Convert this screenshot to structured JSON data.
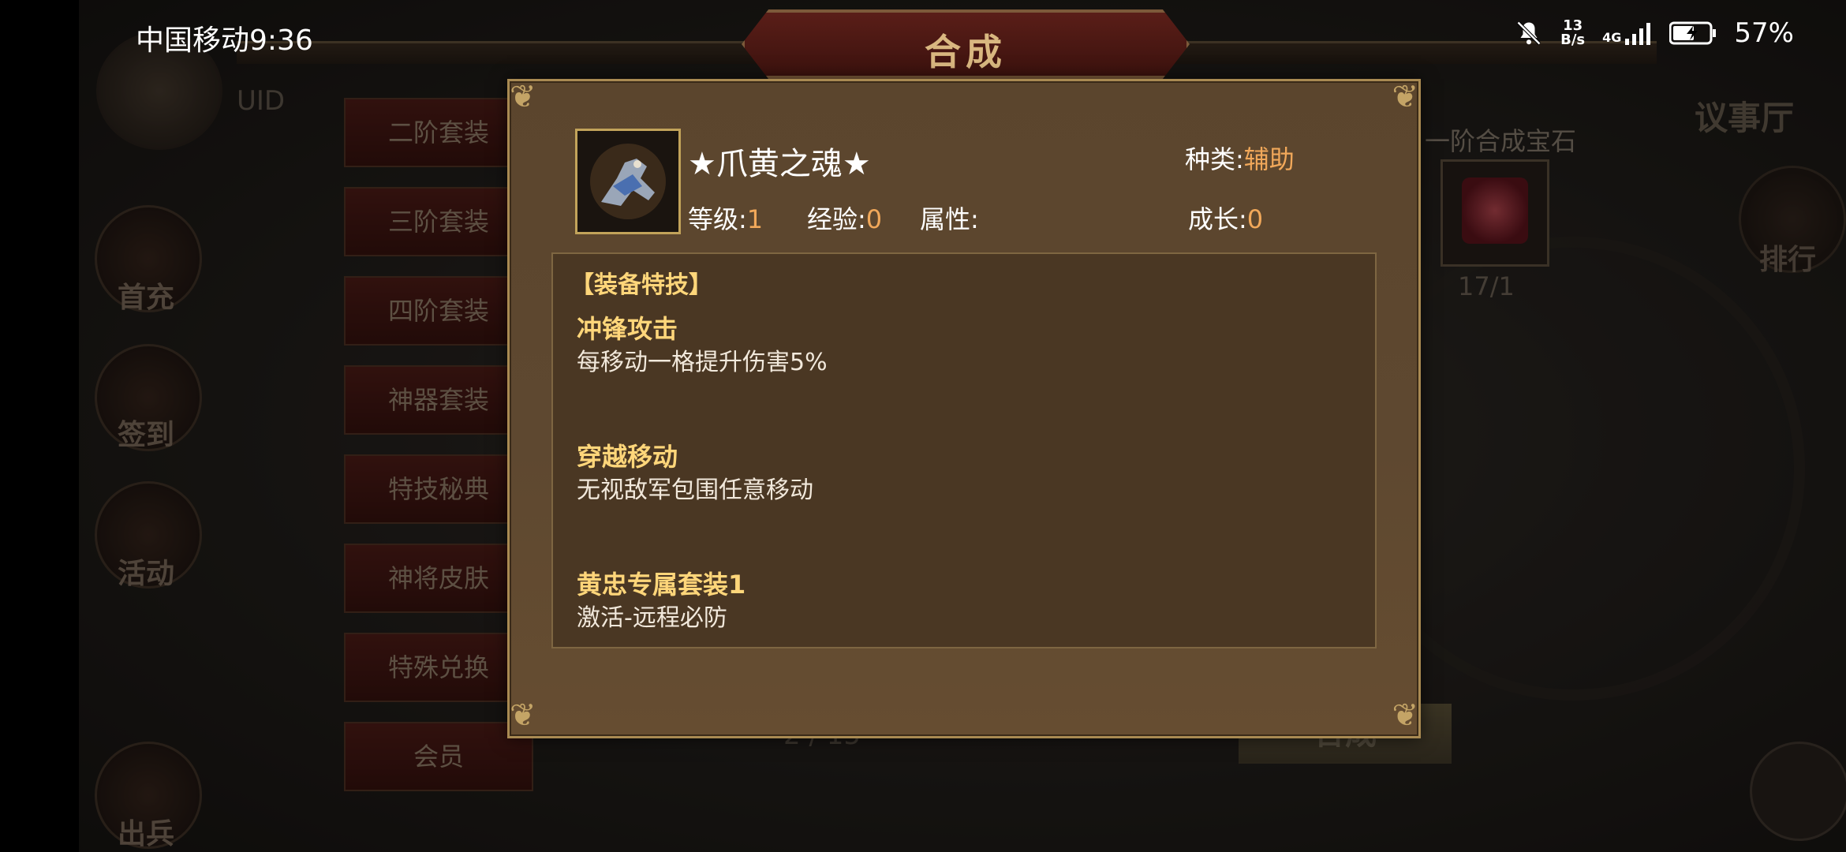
{
  "status_bar": {
    "carrier_time": "中国移动9:36",
    "net_speed_value": "13",
    "net_speed_unit": "B/s",
    "network": "4G",
    "battery": "57%"
  },
  "header": {
    "title": "合成"
  },
  "background": {
    "uid_label": "UID",
    "menu": [
      "二阶套装",
      "三阶套装",
      "四阶套装",
      "神器套装",
      "特技秘典",
      "神将皮肤",
      "特殊兑换",
      "会员"
    ],
    "left_icons": [
      "首充",
      "签到",
      "活动",
      "出兵"
    ],
    "gem_title": "一阶合成宝石",
    "gem_count": "17/1",
    "hall": "议事厅",
    "rank": "排行",
    "page": "2 / 15",
    "synth_button": "合成"
  },
  "item": {
    "name": "★爪黄之魂★",
    "kind_label": "种类:",
    "kind_value": "辅助",
    "level_label": "等级:",
    "level_value": "1",
    "exp_label": "经验:",
    "exp_value": "0",
    "attr_label": "属性:",
    "growth_label": "成长:",
    "growth_value": "0"
  },
  "details": {
    "section_title": "【装备特技】",
    "skills": [
      {
        "title": "冲锋攻击",
        "desc": "每移动一格提升伤害5%"
      },
      {
        "title": "穿越移动",
        "desc": "无视敌军包围任意移动"
      },
      {
        "title": "黄忠专属套装1",
        "desc": "激活-远程必防"
      }
    ]
  },
  "colors": {
    "accent": "#f1a85a",
    "heading": "#ffd67a",
    "panel": "#5e4830"
  }
}
